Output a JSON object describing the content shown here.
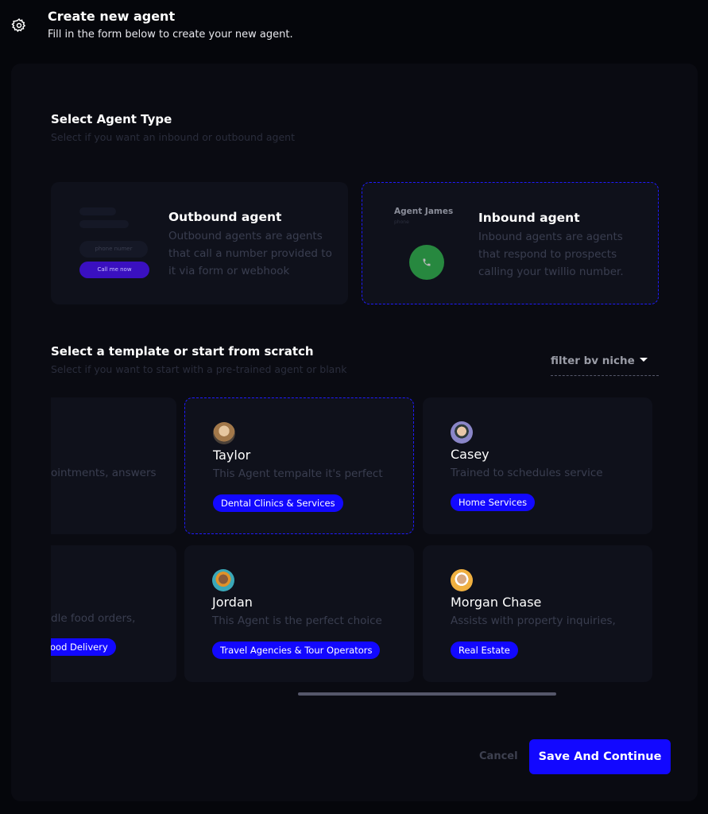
{
  "header": {
    "title": "Create new agent",
    "subtitle": "Fill in the form below to create your new agent.",
    "icon": "gear-icon"
  },
  "agent_type": {
    "title": "Select Agent Type",
    "subtitle": "Select if you want an inbound or outbound agent",
    "outbound": {
      "title": "Outbound agent",
      "description": "Outbound agents are agents that call a number provided to it via form or webhook",
      "preview_input_placeholder": "phone numer",
      "preview_button": "Call me now"
    },
    "inbound": {
      "title": "Inbound agent",
      "description": "Inbound agents are agents that respond to prospects calling your twillio number.",
      "preview_name": "Agent James",
      "preview_label": "phone",
      "selected": true
    }
  },
  "templates": {
    "title": "Select a template or start from scratch",
    "subtitle": "Select if you want to start with a pre-trained agent or blank",
    "filter_label": "filter bv niche",
    "partial": [
      {
        "description": "ointments, answers"
      },
      {
        "description": "dle food orders,",
        "tag": "ood Delivery"
      }
    ],
    "cards": [
      {
        "name": "Taylor",
        "description": "This Agent tempalte it's perfect",
        "tag": "Dental Clinics & Services",
        "selected": true
      },
      {
        "name": "Casey",
        "description": "Trained to schedules service",
        "tag": "Home Services"
      },
      {
        "name": "Jordan",
        "description": "This Agent is the perfect choice",
        "tag": "Travel Agencies & Tour Operators"
      },
      {
        "name": "Morgan Chase",
        "description": "Assists with property inquiries,",
        "tag": "Real Estate"
      }
    ]
  },
  "footer": {
    "cancel": "Cancel",
    "save": "Save And Continue"
  },
  "colors": {
    "accent": "#1208ff",
    "call_green": "#27883f",
    "preview_button": "#3a10c0"
  }
}
